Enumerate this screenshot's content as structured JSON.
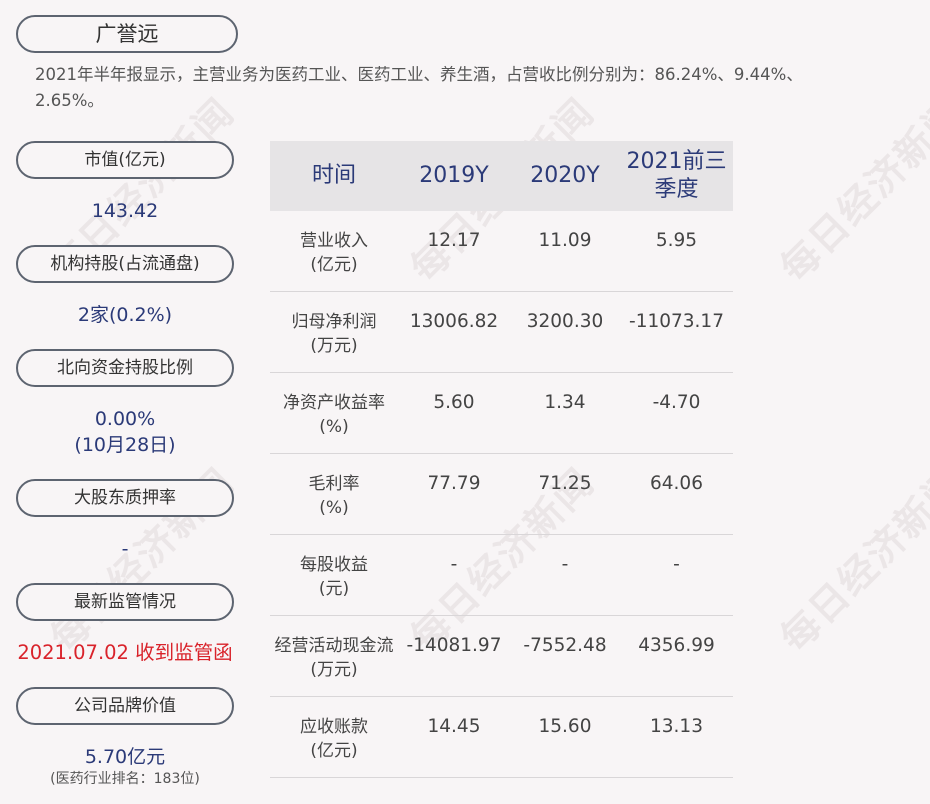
{
  "header": {
    "company": "广誉远",
    "description": "2021年半年报显示，主营业务为医药工业、医药工业、养生酒，占营收比例分别为：86.24%、9.44%、2.65%。"
  },
  "left": {
    "market_cap_label": "市值(亿元)",
    "market_cap_value": "143.42",
    "institution_label": "机构持股(占流通盘)",
    "institution_value": "2家(0.2%)",
    "northbound_label": "北向资金持股比例",
    "northbound_value": "0.00%",
    "northbound_date": "(10月28日)",
    "pledge_label": "大股东质押率",
    "pledge_value": "-",
    "regulation_label": "最新监管情况",
    "regulation_value": "2021.07.02 收到监管函",
    "brand_label": "公司品牌价值",
    "brand_value": "5.70亿元",
    "brand_rank": "(医药行业排名：183位)"
  },
  "table": {
    "headers": [
      "时间",
      "2019Y",
      "2020Y",
      "2021前三季度"
    ],
    "rows": [
      {
        "label": "营业收入",
        "unit": "(亿元)",
        "values": [
          "12.17",
          "11.09",
          "5.95"
        ]
      },
      {
        "label": "归母净利润",
        "unit": "(万元)",
        "values": [
          "13006.82",
          "3200.30",
          "-11073.17"
        ]
      },
      {
        "label": "净资产收益率",
        "unit": "(%)",
        "values": [
          "5.60",
          "1.34",
          "-4.70"
        ]
      },
      {
        "label": "毛利率",
        "unit": "(%)",
        "values": [
          "77.79",
          "71.25",
          "64.06"
        ]
      },
      {
        "label": "每股收益",
        "unit": "(元)",
        "values": [
          "-",
          "-",
          "-"
        ]
      },
      {
        "label": "经营活动现金流",
        "unit": "(万元)",
        "values": [
          "-14081.97",
          "-7552.48",
          "4356.99"
        ]
      },
      {
        "label": "应收账款",
        "unit": "(亿元)",
        "values": [
          "14.45",
          "15.60",
          "13.13"
        ]
      }
    ]
  },
  "watermark": "每日经济新闻"
}
